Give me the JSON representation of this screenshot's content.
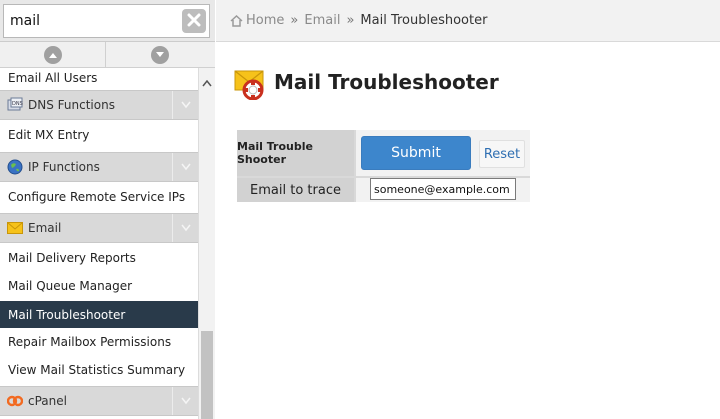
{
  "search": {
    "value": "mail"
  },
  "sidebar": {
    "items": [
      {
        "label": "Email All Users",
        "kind": "link"
      },
      {
        "label": "DNS Functions",
        "kind": "category",
        "icon": "dns-icon"
      },
      {
        "label": "Edit MX Entry",
        "kind": "link"
      },
      {
        "label": "IP Functions",
        "kind": "category",
        "icon": "globe-icon"
      },
      {
        "label": "Configure Remote Service IPs",
        "kind": "link"
      },
      {
        "label": "Email",
        "kind": "category",
        "icon": "envelope-icon"
      },
      {
        "label": "Mail Delivery Reports",
        "kind": "link"
      },
      {
        "label": "Mail Queue Manager",
        "kind": "link"
      },
      {
        "label": "Mail Troubleshooter",
        "kind": "link",
        "active": true
      },
      {
        "label": "Repair Mailbox Permissions",
        "kind": "link"
      },
      {
        "label": "View Mail Statistics Summary",
        "kind": "link"
      },
      {
        "label": "cPanel",
        "kind": "category",
        "icon": "cpanel-icon"
      }
    ]
  },
  "breadcrumb": {
    "home": "Home",
    "separator": "»",
    "section": "Email",
    "current": "Mail Troubleshooter"
  },
  "main": {
    "title": "Mail Troubleshooter",
    "form": {
      "label_top": "Mail Trouble Shooter",
      "submit_label": "Submit",
      "reset_label": "Reset",
      "trace_label": "Email to trace",
      "trace_value": "someone@example.com"
    }
  },
  "colors": {
    "active_item_bg": "#293a4a",
    "submit_bg": "#3d86cc",
    "category_bg": "#d9d9d9"
  }
}
